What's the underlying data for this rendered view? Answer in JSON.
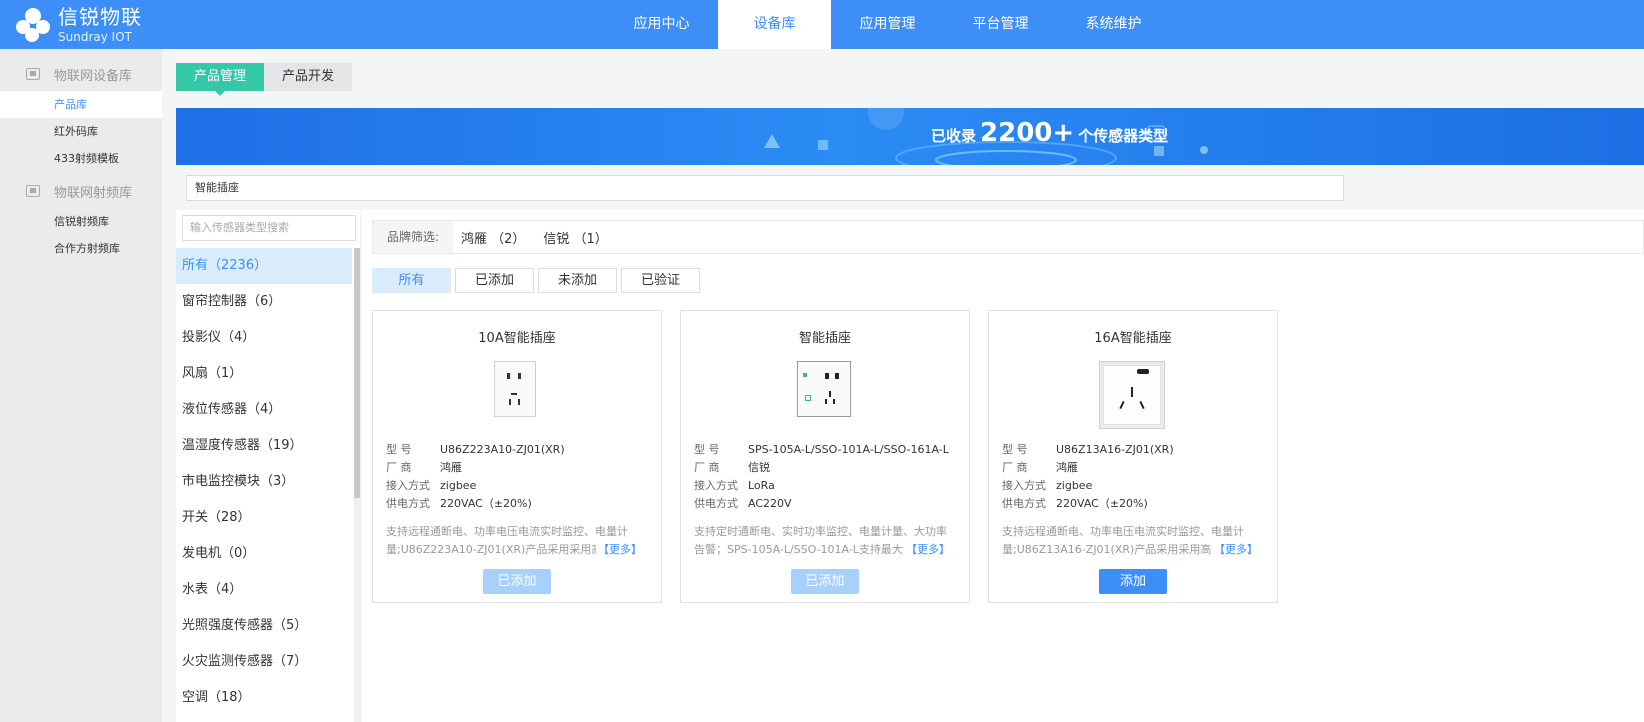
{
  "brand": {
    "name": "信锐物联",
    "sub": "Sundray IOT"
  },
  "nav": [
    "应用中心",
    "设备库",
    "应用管理",
    "平台管理",
    "系统维护"
  ],
  "sidebar": {
    "groups": [
      {
        "label": "物联网设备库",
        "items": [
          "产品库",
          "红外码库",
          "433射频模板"
        ]
      },
      {
        "label": "物联网射频库",
        "items": [
          "信锐射频库",
          "合作方射频库"
        ]
      }
    ]
  },
  "tabs": [
    "产品管理",
    "产品开发"
  ],
  "banner": {
    "prefix": "已收录",
    "num": "2200+",
    "suffix": "个传感器类型"
  },
  "search_value": "智能插座",
  "cat_search_placeholder": "输入传感器类型搜索",
  "categories": [
    "所有（2236）",
    "窗帘控制器（6）",
    "投影仪（4）",
    "风扇（1）",
    "液位传感器（4）",
    "温湿度传感器（19）",
    "市电监控模块（3）",
    "开关（28）",
    "发电机（0）",
    "水表（4）",
    "光照强度传感器（5）",
    "火灾监测传感器（7）",
    "空调（18）"
  ],
  "brand_filter": {
    "label": "品牌筛选:",
    "items": [
      "鸿雁 （2）",
      "信锐 （1）"
    ]
  },
  "status_filters": [
    "所有",
    "已添加",
    "未添加",
    "已验证"
  ],
  "products": [
    {
      "title": "10A智能插座",
      "model_k": "型 号",
      "model": "U86Z223A10-ZJ01(XR)",
      "vendor_k": "厂 商",
      "vendor": "鸿雁",
      "access_k": "接入方式",
      "access": "zigbee",
      "power_k": "供电方式",
      "power": "220VAC（±20%)",
      "desc": "支持远程通断电、功率电压电流实时监控、电量计量;U86Z223A10-ZJ01(XR)产品采用采用高寿命",
      "more": "【更多】",
      "button": "已添加"
    },
    {
      "title": "智能插座",
      "model_k": "型 号",
      "model": "SPS-105A-L/SSO-101A-L/SSO-161A-L",
      "vendor_k": "厂 商",
      "vendor": "信锐",
      "access_k": "接入方式",
      "access": "LoRa",
      "power_k": "供电方式",
      "power": "AC220V",
      "desc": "支持定时通断电、实时功率监控、电量计量、大功率告警；SPS-105A-L/SSO-101A-L支持最大负",
      "more": "【更多】",
      "button": "已添加"
    },
    {
      "title": "16A智能插座",
      "model_k": "型 号",
      "model": "U86Z13A16-ZJ01(XR)",
      "vendor_k": "厂 商",
      "vendor": "鸿雁",
      "access_k": "接入方式",
      "access": "zigbee",
      "power_k": "供电方式",
      "power": "220VAC（±20%)",
      "desc": "支持远程通断电、功率电压电流实时监控、电量计量;U86Z13A16-ZJ01(XR)产品采用采用高寿命",
      "more": "【更多】",
      "button": "添加"
    }
  ],
  "colors": {
    "primary": "#3d8ff7",
    "tab_active": "#35c8a6",
    "added_button": "#a7d0fb"
  }
}
